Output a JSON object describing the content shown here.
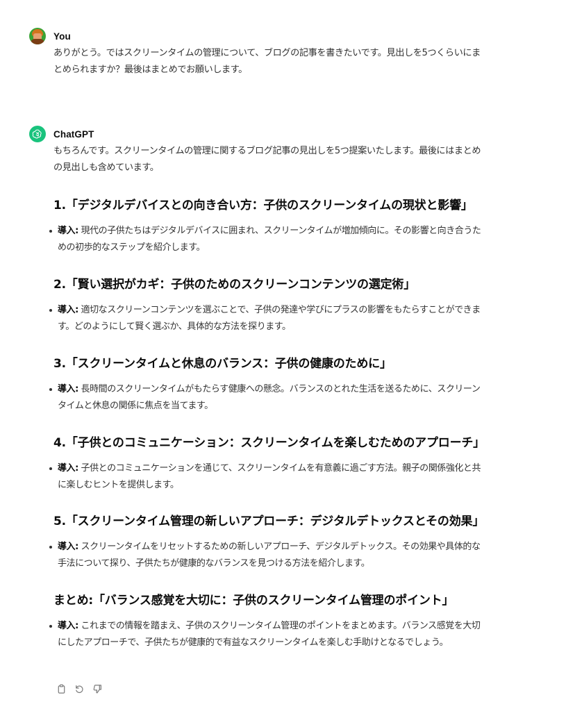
{
  "user_message": {
    "author": "You",
    "text": "ありがとう。ではスクリーンタイムの管理について、ブログの記事を書きたいです。見出しを5つくらいにまとめられますか？最後はまとめでお願いします。"
  },
  "assistant_message": {
    "author": "ChatGPT",
    "intro": "もちろんです。スクリーンタイムの管理に関するブログ記事の見出しを5つ提案いたします。最後にはまとめの見出しも含めています。",
    "sections": [
      {
        "title": "1.「デジタルデバイスとの向き合い方：子供のスクリーンタイムの現状と影響」",
        "lead": "導入:",
        "text": "現代の子供たちはデジタルデバイスに囲まれ、スクリーンタイムが増加傾向に。その影響と向き合うための初歩的なステップを紹介します。"
      },
      {
        "title": "2.「賢い選択がカギ：子供のためのスクリーンコンテンツの選定術」",
        "lead": "導入:",
        "text": "適切なスクリーンコンテンツを選ぶことで、子供の発達や学びにプラスの影響をもたらすことができます。どのようにして賢く選ぶか、具体的な方法を探ります。"
      },
      {
        "title": "3.「スクリーンタイムと休息のバランス：子供の健康のために」",
        "lead": "導入:",
        "text": "長時間のスクリーンタイムがもたらす健康への懸念。バランスのとれた生活を送るために、スクリーンタイムと休息の関係に焦点を当てます。"
      },
      {
        "title": "4.「子供とのコミュニケーション：スクリーンタイムを楽しむためのアプローチ」",
        "lead": "導入:",
        "text": "子供とのコミュニケーションを通じて、スクリーンタイムを有意義に過ごす方法。親子の関係強化と共に楽しむヒントを提供します。"
      },
      {
        "title": "5.「スクリーンタイム管理の新しいアプローチ：デジタルデトックスとその効果」",
        "lead": "導入:",
        "text": "スクリーンタイムをリセットするための新しいアプローチ、デジタルデトックス。その効果や具体的な手法について探り、子供たちが健康的なバランスを見つける方法を紹介します。"
      },
      {
        "title": "まとめ:「バランス感覚を大切に：子供のスクリーンタイム管理のポイント」",
        "lead": "導入:",
        "text": "これまでの情報を踏まえ、子供のスクリーンタイム管理のポイントをまとめます。バランス感覚を大切にしたアプローチで、子供たちが健康的で有益なスクリーンタイムを楽しむ手助けとなるでしょう。"
      }
    ],
    "actions": [
      "copy-icon",
      "regenerate-icon",
      "thumbs-down-icon"
    ]
  },
  "colors": {
    "user_avatar_bg": "#3aa335",
    "bot_avatar_bg": "#19c37d",
    "text": "#333333",
    "heading": "#0d0d0d"
  }
}
